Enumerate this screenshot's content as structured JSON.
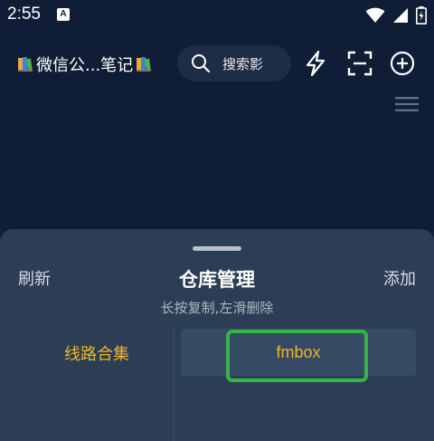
{
  "status_bar": {
    "time": "2:55",
    "notification_badge": "A",
    "icons": [
      "wifi-icon",
      "signal-icon",
      "battery-icon"
    ]
  },
  "header": {
    "title": "微信公...笔记",
    "search_placeholder": "搜索影",
    "actions": [
      "lightning-icon",
      "scan-icon",
      "add-circle-icon"
    ]
  },
  "sheet": {
    "refresh_label": "刷新",
    "title": "仓库管理",
    "add_label": "添加",
    "hint": "长按复制,左滑删除",
    "groups": [
      {
        "label": "线路合集"
      }
    ],
    "items": [
      {
        "label": "fmbox"
      }
    ]
  },
  "colors": {
    "background": "#0f1e36",
    "sheet": "#2c3e55",
    "accent": "#f0b429",
    "highlight": "#36b24a"
  }
}
